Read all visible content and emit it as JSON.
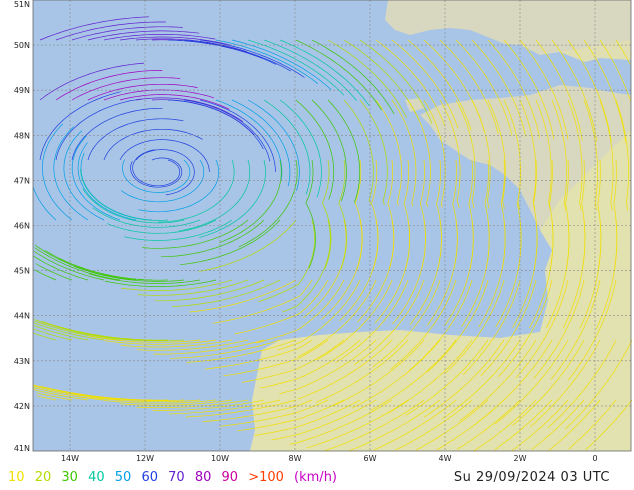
{
  "map": {
    "latitude_labels": [
      "51N",
      "50N",
      "49N",
      "48N",
      "47N",
      "46N",
      "45N",
      "44N",
      "43N",
      "42N",
      "41N"
    ],
    "longitude_labels": [
      "14W",
      "12W",
      "10W",
      "8W",
      "6W",
      "4W",
      "2W",
      "0"
    ]
  },
  "legend": {
    "items": [
      {
        "label": "10",
        "color": "#f0e000"
      },
      {
        "label": "20",
        "color": "#b4dc00"
      },
      {
        "label": "30",
        "color": "#3cc800"
      },
      {
        "label": "40",
        "color": "#00c8a0"
      },
      {
        "label": "50",
        "color": "#00a0e6"
      },
      {
        "label": "60",
        "color": "#2040e0"
      },
      {
        "label": "70",
        "color": "#6020d0"
      },
      {
        "label": "80",
        "color": "#a000c0"
      },
      {
        "label": "90",
        "color": "#c800a0"
      },
      {
        "label": ">100",
        "color": "#ff3c00"
      }
    ],
    "unit": "(km/h)",
    "unit_color": "#c800c8"
  },
  "timestamp": "Su 29/09/2024 03 UTC",
  "colors": {
    "sea": "#a8c4e6",
    "land": "#d8d8c0",
    "grid": "#999999"
  }
}
